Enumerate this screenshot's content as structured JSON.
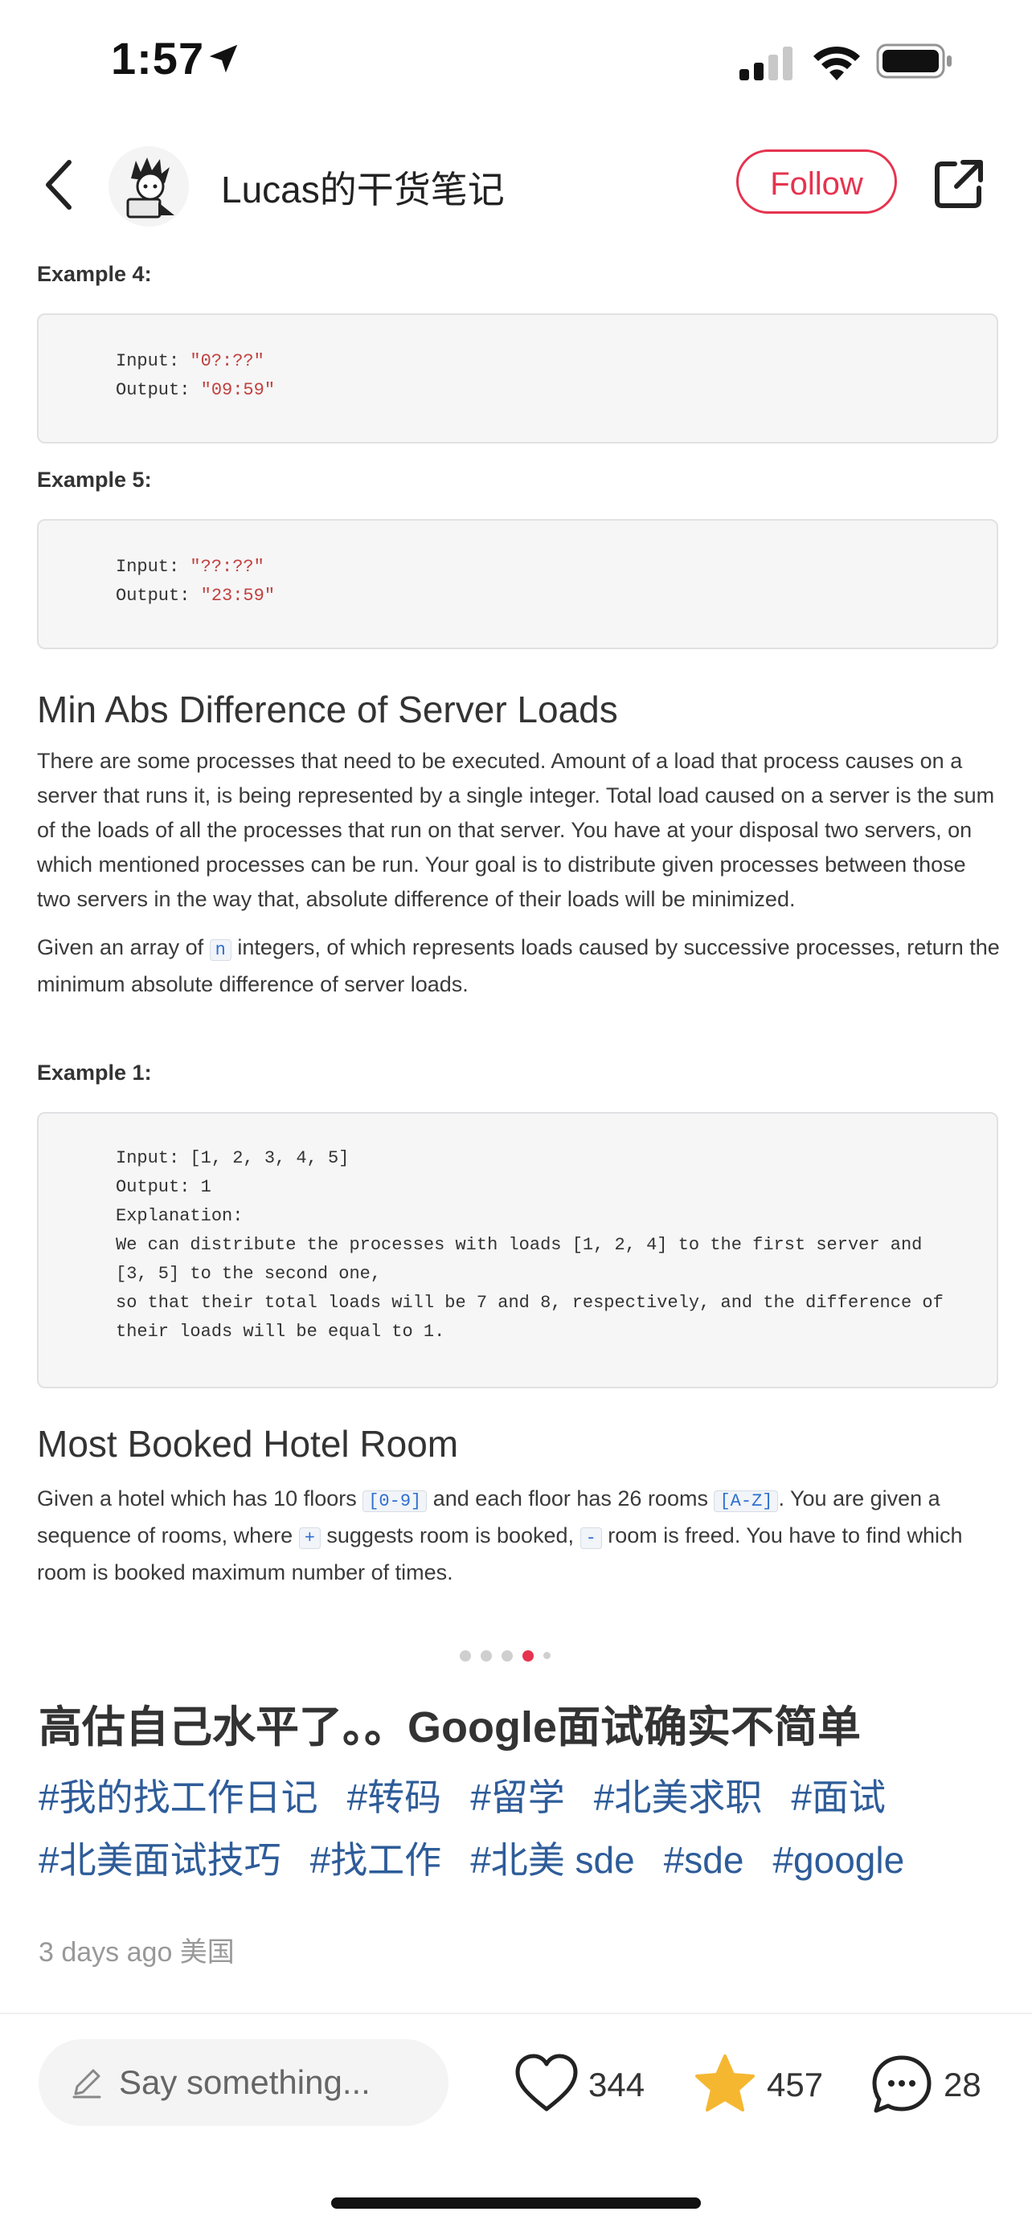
{
  "status_bar": {
    "time": "1:57"
  },
  "header": {
    "author": "Lucas的干货笔记",
    "follow_label": "Follow"
  },
  "post_image": {
    "example4": {
      "label": "Example 4:",
      "input_key": "Input: ",
      "input_value": "\"0?:??\"",
      "output_key": "Output: ",
      "output_value": "\"09:59\""
    },
    "example5": {
      "label": "Example 5:",
      "input_key": "Input: ",
      "input_value": "\"??:??\"",
      "output_key": "Output: ",
      "output_value": "\"23:59\""
    },
    "section1": {
      "title": "Min Abs Difference of Server Loads",
      "para1": "There are some processes that need to be executed. Amount of a load that process causes on a server that runs it, is being represented by a single integer. Total load caused on a server is the sum of the loads of all the processes that run on that server. You have at your disposal two servers, on which mentioned processes can be run. Your goal is to distribute given processes between those two servers in the way that, absolute difference of their loads will be minimized.",
      "para2_a": "Given an array of ",
      "para2_code": "n",
      "para2_b": " integers, of which represents loads caused by successive processes, return the minimum absolute difference of server loads.",
      "example_label": "Example 1:",
      "code_line1": "Input: [1, 2, 3, 4, 5]",
      "code_line2": "Output: 1",
      "code_line3": "Explanation:",
      "code_line4": "We can distribute the processes with loads [1, 2, 4] to the first server and",
      "code_line5": "[3, 5] to the second one,",
      "code_line6": "so that their total loads will be 7 and 8, respectively, and the difference of",
      "code_line7": "their loads will be equal to 1."
    },
    "section2": {
      "title": "Most Booked Hotel Room",
      "text_a": "Given a hotel which has 10 floors ",
      "code_a": "[0-9]",
      "text_b": " and each floor has 26 rooms ",
      "code_b": "[A-Z]",
      "text_c": ". You are given a sequence of rooms, where ",
      "code_c": "+",
      "text_d": " suggests room is booked, ",
      "code_d": "-",
      "text_e": " room is freed. You have to find which room is booked maximum number of times."
    }
  },
  "carousel": {
    "active_index": 3,
    "count": 5
  },
  "post": {
    "title": "高估自己水平了。。Google面试确实不简单",
    "tags": [
      "#我的找工作日记",
      "#转码",
      "#留学",
      "#北美求职",
      "#面试",
      "#北美面试技巧",
      "#找工作",
      "#北美 sde",
      "#sde",
      "#google"
    ],
    "meta": "3 days ago 美国"
  },
  "bottom_bar": {
    "comment_placeholder": "Say something...",
    "likes": "344",
    "stars": "457",
    "comments": "28"
  },
  "colors": {
    "accent": "#e6334f",
    "tag": "#2e5c99",
    "star": "#f5b730"
  },
  "icons": [
    "location-arrow-icon",
    "signal-icon",
    "wifi-icon",
    "battery-icon",
    "back-chevron-icon",
    "share-icon",
    "pencil-icon",
    "heart-icon",
    "star-icon",
    "comment-bubble-icon"
  ]
}
